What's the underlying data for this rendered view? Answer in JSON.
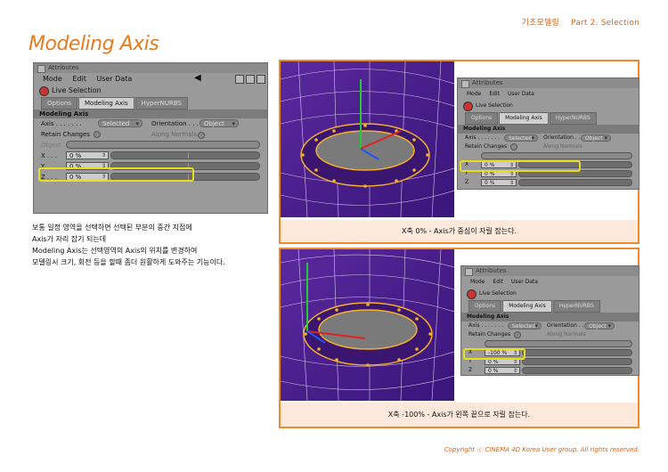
{
  "header": {
    "chapter": "기초모델링",
    "part": "Part 2. Selection"
  },
  "page_title": "Modeling Axis",
  "panel": {
    "window_title": "Attributes",
    "menu": [
      "Mode",
      "Edit",
      "User Data"
    ],
    "tool_name": "Live Selection",
    "tabs": [
      "Options",
      "Modeling Axis",
      "HyperNURBS"
    ],
    "section": "Modeling Axis",
    "axis_label": "Axis . . . . . . .",
    "axis_value": "Selected",
    "orientation_label": "Orientation . . .",
    "orientation_value": "Object",
    "retain_label": "Retain Changes",
    "along_normals_label": "Along Normals",
    "object_label": "Object",
    "x_label": "X . . .",
    "y_label": "Y . . .",
    "z_label": "Z . . .",
    "x_value": "0 %",
    "y_value": "0 %",
    "z_value": "0 %"
  },
  "panel2": {
    "x_value": "0 %"
  },
  "panel3": {
    "x_value": "-100 %"
  },
  "description": [
    "보통 일정 영역을 선택하면 선택된 부분의 중간 지점에",
    "Axis가 자리 잡기 되는데",
    "Modeling Axis는 선택영역의 Axis의 위치를 변경하여",
    "모델링시 크기, 회전 등을 할때 좀더 원활하게 도와주는 기능이다."
  ],
  "caption_top": "X축 0% - Axis가 중심이 자릴 잡는다.",
  "caption_bottom": "X축 -100% - Axis가 왼쪽 끝으로 자릴 잡는다.",
  "footer": "Copyright ⓒ CINEMA 4D Korea User group. All rights reserved.",
  "colors": {
    "accent": "#e87a1e",
    "highlight": "#e8df1c",
    "viewport": "#4b1f8c"
  }
}
